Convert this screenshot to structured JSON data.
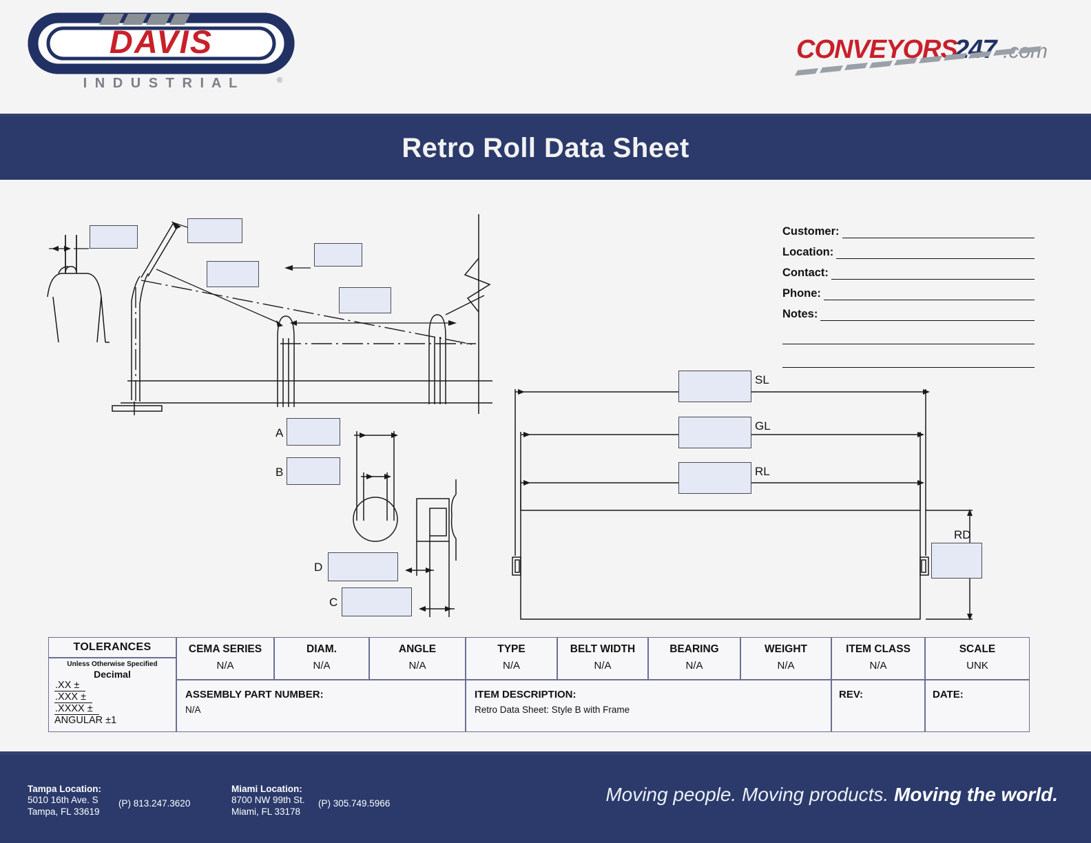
{
  "header": {
    "davis_logo": {
      "name": "DAVIS",
      "sub": "I N D U S T R I A L",
      "reg": "®"
    },
    "conveyors_logo": {
      "part1": "CONVEYORS",
      "part2": "247",
      "part3": ".com"
    }
  },
  "title_bar": {
    "title": "Retro Roll Data Sheet"
  },
  "customer_block": {
    "fields": [
      {
        "label": "Customer:",
        "value": ""
      },
      {
        "label": "Location:",
        "value": ""
      },
      {
        "label": "Contact:",
        "value": ""
      },
      {
        "label": "Phone:",
        "value": ""
      },
      {
        "label": "Notes:",
        "value": ""
      }
    ],
    "extra_blank_lines": 2
  },
  "drawings": {
    "frame_profile": {
      "caption": "conveyor idler frame profile view",
      "inputs": [
        {
          "id": "frame-in-1",
          "value": ""
        },
        {
          "id": "frame-in-2",
          "value": ""
        },
        {
          "id": "frame-in-3",
          "value": ""
        },
        {
          "id": "frame-in-4",
          "value": ""
        },
        {
          "id": "frame-in-5",
          "value": ""
        }
      ]
    },
    "roll_detail": {
      "caption": "roll end / bracket detail view",
      "labels": [
        "A",
        "B",
        "D",
        "C"
      ],
      "inputs": [
        {
          "id": "detail-in-a",
          "value": ""
        },
        {
          "id": "detail-in-b",
          "value": ""
        },
        {
          "id": "detail-in-d",
          "value": ""
        },
        {
          "id": "detail-in-c",
          "value": ""
        }
      ]
    },
    "roll_dimensions": {
      "caption": "roll overall dimensions view",
      "labels": [
        "SL",
        "GL",
        "RL",
        "RD"
      ],
      "inputs": [
        {
          "id": "dim-in-sl",
          "value": ""
        },
        {
          "id": "dim-in-gl",
          "value": ""
        },
        {
          "id": "dim-in-rl",
          "value": ""
        },
        {
          "id": "dim-in-rd",
          "value": ""
        }
      ]
    }
  },
  "table": {
    "tolerances": {
      "title": "TOLERANCES",
      "note": "Unless Otherwise Specified",
      "decimal": "Decimal",
      "items": [
        ".XX ±",
        ".XXX ±",
        ".XXXX ±",
        "ANGULAR ±1"
      ]
    },
    "spec_columns": [
      {
        "header": "CEMA SERIES",
        "value": "N/A"
      },
      {
        "header": "DIAM.",
        "value": "N/A"
      },
      {
        "header": "ANGLE",
        "value": "N/A"
      },
      {
        "header": "TYPE",
        "value": "N/A"
      },
      {
        "header": "BELT WIDTH",
        "value": "N/A"
      },
      {
        "header": "BEARING",
        "value": "N/A"
      },
      {
        "header": "WEIGHT",
        "value": "N/A"
      },
      {
        "header": "ITEM CLASS",
        "value": "N/A"
      },
      {
        "header": "SCALE",
        "value": "UNK"
      }
    ],
    "assembly_part_number": {
      "label": "ASSEMBLY PART NUMBER:",
      "value": "N/A"
    },
    "item_description": {
      "label": "ITEM DESCRIPTION:",
      "value": "Retro Data Sheet: Style B with Frame"
    },
    "rev": {
      "label": "REV:",
      "value": ""
    },
    "date": {
      "label": "DATE:",
      "value": ""
    }
  },
  "footer": {
    "tampa": {
      "title": "Tampa Location:",
      "street": "5010 16th Ave. S",
      "city": "Tampa, FL 33619",
      "phone": "(P) 813.247.3620"
    },
    "miami": {
      "title": "Miami Location:",
      "street": "8700 NW 99th St.",
      "city": "Miami, FL 33178",
      "phone": "(P) 305.749.5966"
    },
    "tagline_light": "Moving people. Moving products. ",
    "tagline_bold": "Moving the world."
  },
  "colors": {
    "navy": "#2b3a6b",
    "red": "#c8202a",
    "gray": "#7b7f86",
    "page_bg": "#f4f4f5",
    "input_fill": "#e4e9f5",
    "table_border": "#6a6f93"
  }
}
